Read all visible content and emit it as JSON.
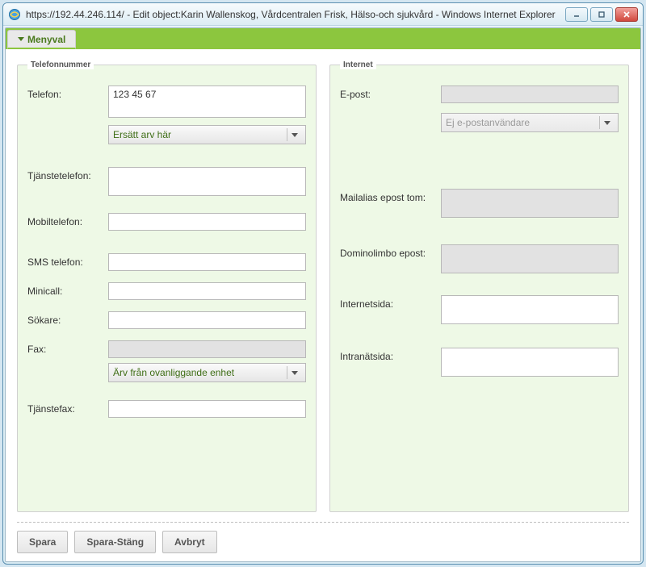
{
  "window": {
    "title": "https://192.44.246.114/ - Edit object:Karin Wallenskog, Vårdcentralen Frisk, Hälso-och sjukvård - Windows Internet Explorer"
  },
  "menu": {
    "label": "Menyval"
  },
  "panels": {
    "phone": {
      "legend": "Telefonnummer",
      "telefon_label": "Telefon:",
      "telefon_value": "123 45 67",
      "telefon_select": "Ersätt arv här",
      "tjanstetelefon_label": "Tjänstetelefon:",
      "tjanstetelefon_value": "",
      "mobiltelefon_label": "Mobiltelefon:",
      "mobiltelefon_value": "",
      "sms_label": "SMS telefon:",
      "sms_value": "",
      "minicall_label": "Minicall:",
      "minicall_value": "",
      "sokare_label": "Sökare:",
      "sokare_value": "",
      "fax_label": "Fax:",
      "fax_value": "",
      "fax_select": "Ärv från ovanliggande enhet",
      "tjanstefax_label": "Tjänstefax:",
      "tjanstefax_value": ""
    },
    "internet": {
      "legend": "Internet",
      "epost_label": "E-post:",
      "epost_value": "",
      "epost_select": "Ej e-postanvändare",
      "mailalias_label": "Mailalias epost tom:",
      "mailalias_value": "",
      "dominolimbo_label": "Dominolimbo epost:",
      "dominolimbo_value": "",
      "internetsida_label": "Internetsida:",
      "internetsida_value": "",
      "intranatsida_label": "Intranätsida:",
      "intranatsida_value": ""
    }
  },
  "buttons": {
    "spara": "Spara",
    "spara_stang": "Spara-Stäng",
    "avbryt": "Avbryt"
  }
}
